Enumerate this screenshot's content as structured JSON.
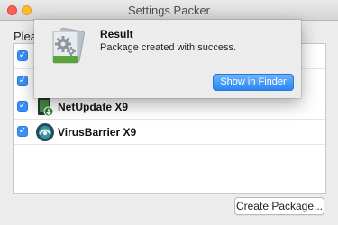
{
  "window": {
    "title": "Settings Packer"
  },
  "prompt": "Pleas",
  "apps": [
    {
      "name": "",
      "checked": "✓"
    },
    {
      "name": "",
      "checked": "✓"
    },
    {
      "name": "NetUpdate X9",
      "checked": "✓"
    },
    {
      "name": "VirusBarrier X9",
      "checked": "✓"
    }
  ],
  "buttons": {
    "create_package": "Create Package..."
  },
  "sheet": {
    "title": "Result",
    "message": "Package created with success.",
    "show_in_finder": "Show in Finder"
  },
  "colors": {
    "accent": "#3b8ff6",
    "close": "#fc5f57",
    "minimize": "#fdbc2e"
  }
}
